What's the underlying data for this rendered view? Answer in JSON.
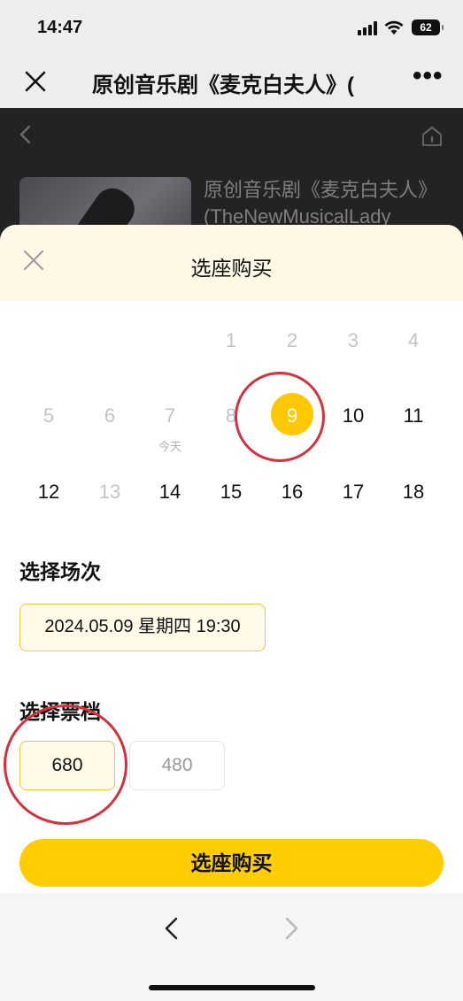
{
  "status_bar": {
    "time": "14:47",
    "battery": "62"
  },
  "nav": {
    "title": "原创音乐剧《麦克白夫人》("
  },
  "background_page": {
    "show_title_line1": "原创音乐剧《麦克白夫人》",
    "show_title_line2": "(TheNewMusicalLady"
  },
  "sheet": {
    "title": "选座购买",
    "calendar": {
      "rows": [
        [
          "",
          "",
          "",
          "",
          "1",
          "2",
          "3",
          "4"
        ],
        [
          "5",
          "6",
          "7",
          "8",
          "9",
          "10",
          "11"
        ],
        [
          "12",
          "13",
          "14",
          "15",
          "16",
          "17",
          "18"
        ]
      ],
      "selected_day": "9",
      "today_label": "今天"
    },
    "session_section_title": "选择场次",
    "session_value": "2024.05.09 星期四 19:30",
    "ticket_section_title": "选择票档",
    "tickets": [
      {
        "label": "680",
        "selected": true
      },
      {
        "label": "480",
        "selected": false
      }
    ],
    "buy_button": "选座购买"
  },
  "colors": {
    "accent": "#ffcd00",
    "annotation": "#d8303b"
  }
}
